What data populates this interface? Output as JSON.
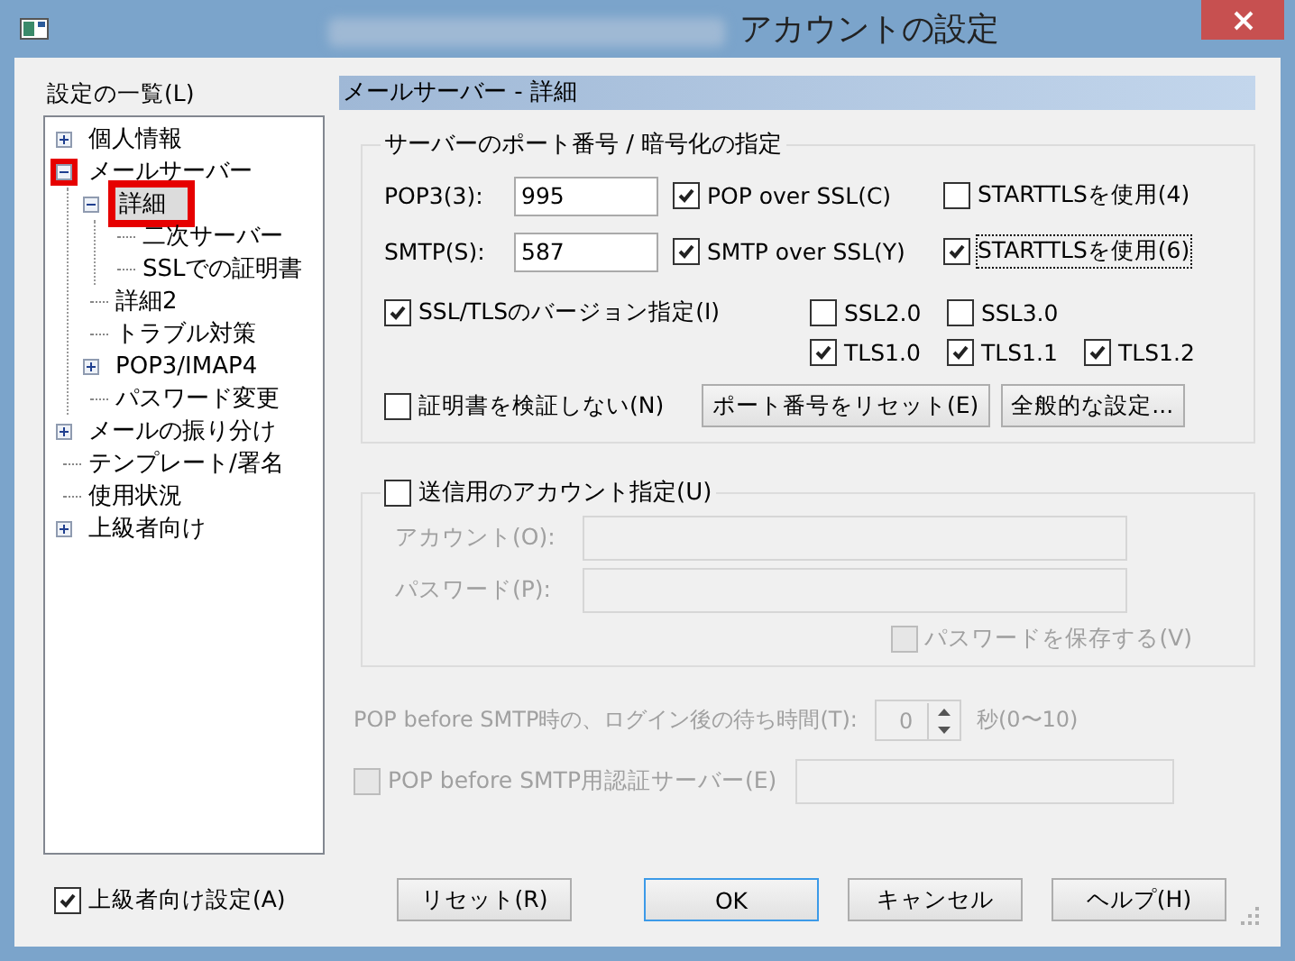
{
  "window": {
    "title": "アカウントの設定"
  },
  "sidebar": {
    "label": "設定の一覧(L)",
    "tree": [
      {
        "label": "個人情報",
        "expanded": false,
        "selected": false
      },
      {
        "label": "メールサーバー",
        "expanded": true,
        "selected": false,
        "toggle_highlighted": true,
        "children": [
          {
            "label": "詳細",
            "expanded": true,
            "selected": true,
            "label_highlighted": true,
            "children": [
              {
                "label": "二次サーバー",
                "selected": false
              },
              {
                "label": "SSLでの証明書",
                "selected": false
              }
            ]
          },
          {
            "label": "詳細2",
            "selected": false
          },
          {
            "label": "トラブル対策",
            "selected": false
          },
          {
            "label": "POP3/IMAP4",
            "expanded": false,
            "selected": false
          },
          {
            "label": "パスワード変更",
            "selected": false
          }
        ]
      },
      {
        "label": "メールの振り分け",
        "expanded": false,
        "selected": false
      },
      {
        "label": "テンプレート/署名",
        "selected": false
      },
      {
        "label": "使用状況",
        "selected": false
      },
      {
        "label": "上級者向け",
        "expanded": false,
        "selected": false
      }
    ],
    "advanced": {
      "label": "上級者向け設定(A)",
      "checked": true
    }
  },
  "panel": {
    "title": "メールサーバー - 詳細",
    "ports_group": {
      "title": "サーバーのポート番号 / 暗号化の指定",
      "rows": [
        {
          "label": "POP3(3):",
          "value": "995",
          "options": [
            {
              "label": "POP over SSL(C)",
              "checked": true,
              "focused": false
            },
            {
              "label": "STARTTLSを使用(4)",
              "checked": false,
              "focused": false
            }
          ]
        },
        {
          "label": "SMTP(S):",
          "value": "587",
          "options": [
            {
              "label": "SMTP over SSL(Y)",
              "checked": true,
              "focused": false
            },
            {
              "label": "STARTTLSを使用(6)",
              "checked": true,
              "focused": true
            }
          ]
        }
      ],
      "version_option": {
        "label": "SSL/TLSのバージョン指定(I)",
        "checked": true
      },
      "version_rows": [
        [
          {
            "label": "SSL2.0",
            "checked": false
          },
          {
            "label": "SSL3.0",
            "checked": false
          }
        ],
        [
          {
            "label": "TLS1.0",
            "checked": true
          },
          {
            "label": "TLS1.1",
            "checked": true
          },
          {
            "label": "TLS1.2",
            "checked": true
          }
        ]
      ],
      "no_verify": {
        "label": "証明書を検証しない(N)",
        "checked": false
      },
      "buttons": [
        "ポート番号をリセット(E)",
        "全般的な設定..."
      ]
    },
    "auth_group": {
      "label": "送信用のアカウント指定(U)",
      "checked": false,
      "fields": [
        {
          "label": "アカウント(O):",
          "disabled": true
        },
        {
          "label": "パスワード(P):",
          "disabled": true
        }
      ],
      "save_password": {
        "label": "パスワードを保存する(V)",
        "checked": false,
        "disabled": true
      }
    },
    "wait": {
      "label": "POP before SMTP時の、ログイン後の待ち時間(T):",
      "value": "0",
      "unit": "秒(0〜10)",
      "disabled": true
    },
    "auth_server": {
      "label": "POP before SMTP用認証サーバー(E)",
      "checked": false,
      "disabled": true
    }
  },
  "buttons": [
    {
      "label": "リセット(R)",
      "default": false
    },
    {
      "label": "OK",
      "default": true
    },
    {
      "label": "キャンセル",
      "default": false
    },
    {
      "label": "ヘルプ(H)",
      "default": false
    }
  ]
}
